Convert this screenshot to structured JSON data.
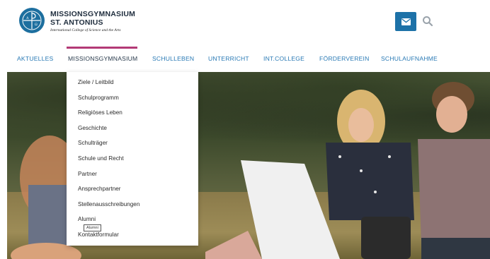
{
  "brand": {
    "name_line1": "MISSIONSGYMNASIUM",
    "name_line2": "ST. ANTONIUS",
    "subtitle": "International College of Science and the Arts",
    "accent_color": "#1d72a8"
  },
  "header": {
    "mail_icon": "envelope-icon",
    "search_icon": "search-icon"
  },
  "nav": {
    "items": [
      {
        "label": "AKTUELLES"
      },
      {
        "label": "MISSIONSGYMNASIUM"
      },
      {
        "label": "SCHULLEBEN"
      },
      {
        "label": "UNTERRICHT"
      },
      {
        "label": "INT.COLLEGE"
      },
      {
        "label": "FÖRDERVEREIN"
      },
      {
        "label": "SCHULAUFNAHME"
      }
    ],
    "active_index": 1,
    "active_color": "#b33a76"
  },
  "dropdown": {
    "items": [
      {
        "label": "Ziele / Leitbild"
      },
      {
        "label": "Schulprogramm"
      },
      {
        "label": "Religiöses Leben"
      },
      {
        "label": "Geschichte"
      },
      {
        "label": "Schulträger"
      },
      {
        "label": "Schule und Recht"
      },
      {
        "label": "Partner"
      },
      {
        "label": "Ansprechpartner"
      },
      {
        "label": "Stellenausschreibungen"
      },
      {
        "label": "Alumni"
      },
      {
        "label": "Kontaktformular"
      }
    ],
    "hovered_index": 9,
    "tooltip": "Alumni"
  }
}
